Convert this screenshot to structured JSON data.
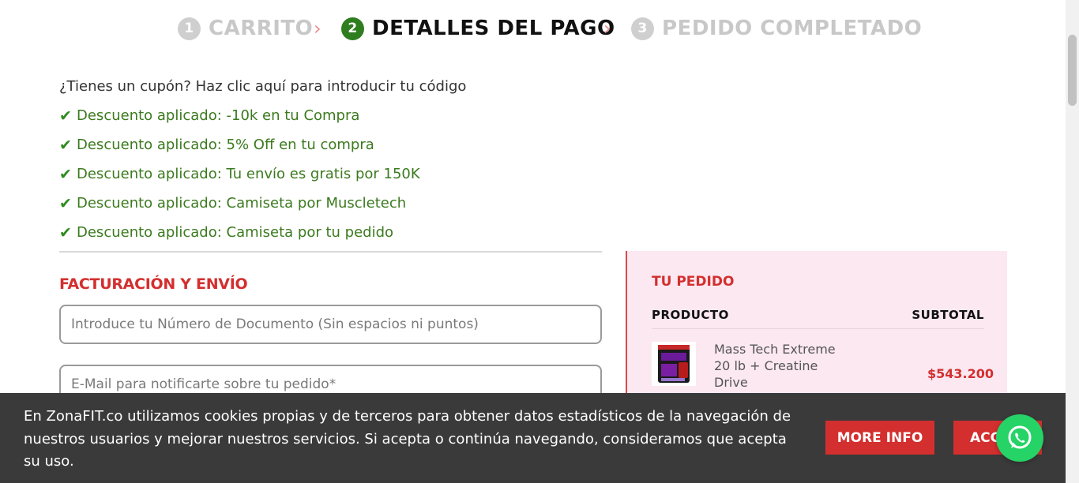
{
  "steps": [
    {
      "number": "1",
      "label": "CARRITO",
      "state": "inactive"
    },
    {
      "number": "2",
      "label": "DETALLES DEL PAGO",
      "state": "active"
    },
    {
      "number": "3",
      "label": "PEDIDO COMPLETADO",
      "state": "inactive"
    }
  ],
  "coupon": {
    "question": "¿Tienes un cupón?",
    "link": "Haz clic aquí para introducir tu código"
  },
  "discounts": [
    "Descuento aplicado: -10k en tu Compra",
    "Descuento aplicado: 5% Off en tu compra",
    "Descuento aplicado: Tu envío es gratis por 150K",
    "Descuento aplicado: Camiseta por Muscletech",
    "Descuento aplicado: Camiseta por tu pedido"
  ],
  "billing": {
    "title": "FACTURACIÓN Y ENVÍO",
    "document_placeholder": "Introduce tu Número de Documento (Sin espacios ni puntos)",
    "email_placeholder": "E-Mail para notificarte sobre tu pedido*"
  },
  "order": {
    "title": "TU PEDIDO",
    "col_product": "PRODUCTO",
    "col_subtotal": "SUBTOTAL",
    "items": [
      {
        "name": "Mass Tech Extreme 20 lb + Creatine Drive",
        "price": "$543.200"
      }
    ]
  },
  "cookie": {
    "text": "En ZonaFIT.co utilizamos cookies propias y de terceros para obtener datos estadísticos de la navegación de nuestros usuarios y mejorar nuestros servicios. Si acepta o continúa navegando, consideramos que acepta su uso.",
    "more_info": "MORE INFO",
    "accept": "ACCEPT"
  },
  "colors": {
    "accent_red": "#d32f2f",
    "success_green": "#3b7a1e",
    "active_step": "#2e7d1f",
    "order_bg": "#fbe8f1",
    "whatsapp": "#25d366"
  }
}
